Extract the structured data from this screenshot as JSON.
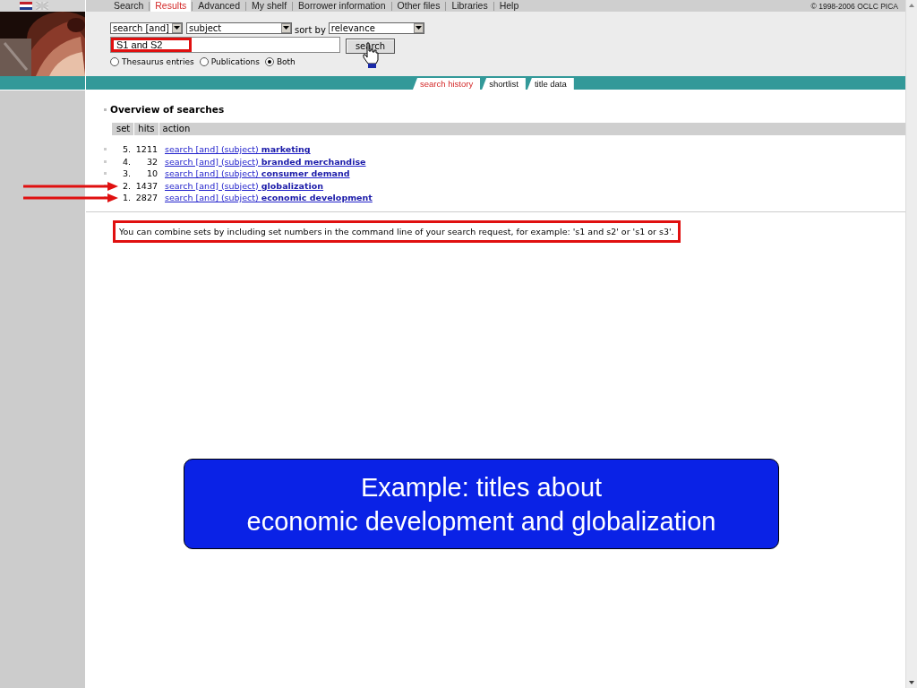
{
  "nav": {
    "items": [
      {
        "label": "Search",
        "selected": false
      },
      {
        "label": "Results",
        "selected": true
      },
      {
        "label": "Advanced",
        "selected": false
      },
      {
        "label": "My shelf",
        "selected": false
      },
      {
        "label": "Borrower information",
        "selected": false
      },
      {
        "label": "Other files",
        "selected": false
      },
      {
        "label": "Libraries",
        "selected": false
      },
      {
        "label": "Help",
        "selected": false
      }
    ],
    "copyright": "© 1998-2006 OCLC PICA"
  },
  "search_form": {
    "operator": "search [and]",
    "field": "subject",
    "sort_label": "sort by",
    "sort": "relevance",
    "query": {
      "value": "S1 and S2",
      "highlighted": true
    },
    "button": "search",
    "scope": [
      {
        "label": "Thesaurus entries",
        "selected": false
      },
      {
        "label": "Publications",
        "selected": false
      },
      {
        "label": "Both",
        "selected": true
      }
    ]
  },
  "tabs": [
    {
      "label": "search history",
      "selected": true
    },
    {
      "label": "shortlist",
      "selected": false
    },
    {
      "label": "title data",
      "selected": false
    }
  ],
  "history": {
    "title": "Overview of searches",
    "columns": [
      "set",
      "hits",
      "action"
    ],
    "rows": [
      {
        "set": "5.",
        "hits": "1211",
        "action": "search [and] (subject)",
        "term": "marketing",
        "annotated": false
      },
      {
        "set": "4.",
        "hits": "32",
        "action": "search [and] (subject)",
        "term": "branded merchandise",
        "annotated": false
      },
      {
        "set": "3.",
        "hits": "10",
        "action": "search [and] (subject)",
        "term": "consumer demand",
        "annotated": false
      },
      {
        "set": "2.",
        "hits": "1437",
        "action": "search [and] (subject)",
        "term": "globalization",
        "annotated": true
      },
      {
        "set": "1.",
        "hits": "2827",
        "action": "search [and] (subject)",
        "term": "economic development",
        "annotated": true
      }
    ],
    "note": {
      "text": "You can combine sets by including set numbers in the command line of your search request, for example: 's1 and s2' or 's1 or s3'.",
      "highlighted": true
    }
  },
  "callout": {
    "lines": [
      "Example: titles about",
      "economic development and globalization"
    ]
  }
}
